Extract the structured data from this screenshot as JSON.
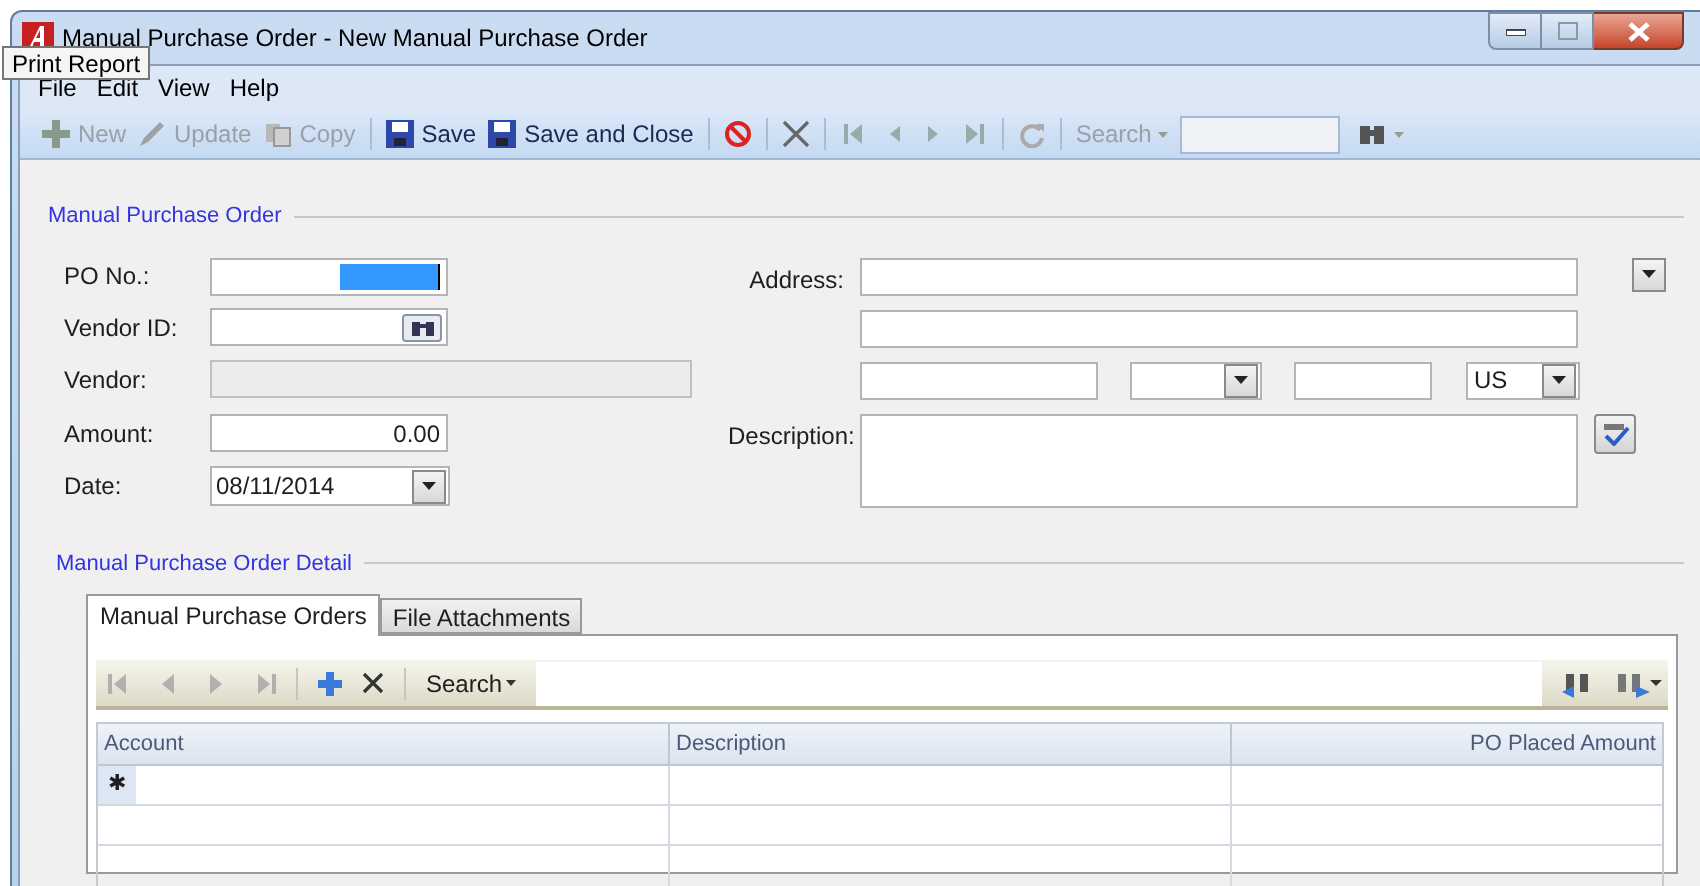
{
  "window": {
    "title": "Manual Purchase Order - New Manual Purchase Order"
  },
  "tooltip": {
    "text": "Print Report"
  },
  "menu": [
    "File",
    "Edit",
    "View",
    "Help"
  ],
  "toolbar": [
    {
      "kind": "new",
      "label": "New",
      "disabled": true
    },
    {
      "kind": "update",
      "label": "Update",
      "disabled": true
    },
    {
      "kind": "copy",
      "label": "Copy",
      "disabled": true
    },
    {
      "kind": "separator"
    },
    {
      "kind": "save",
      "label": "Save",
      "disabled": false
    },
    {
      "kind": "save",
      "label": "Save and Close",
      "disabled": false
    },
    {
      "kind": "separator"
    },
    {
      "kind": "cancel",
      "disabled": false
    },
    {
      "kind": "separator"
    },
    {
      "kind": "delete",
      "disabled": false
    },
    {
      "kind": "separator"
    },
    {
      "kind": "first",
      "disabled": true
    },
    {
      "kind": "prev",
      "disabled": true
    },
    {
      "kind": "next",
      "disabled": true
    },
    {
      "kind": "last",
      "disabled": true
    },
    {
      "kind": "separator"
    },
    {
      "kind": "refresh",
      "disabled": true
    },
    {
      "kind": "separator"
    },
    {
      "kind": "search",
      "label": "Search",
      "disabled": true
    },
    {
      "kind": "find",
      "disabled": true
    }
  ],
  "order": {
    "title": "Manual Purchase Order",
    "po_no": {
      "label": "PO No.:",
      "focused": true
    },
    "vendor_id": {
      "label": "Vendor ID:"
    },
    "vendor": {
      "label": "Vendor:",
      "disabled": true
    },
    "amount": {
      "label": "Amount:",
      "value": "0.00"
    },
    "date": {
      "label": "Date:",
      "value": "08/11/2014"
    },
    "address": {
      "label": "Address:"
    },
    "country": {
      "value": "US"
    },
    "description": {
      "label": "Description:"
    }
  },
  "detail": {
    "title": "Manual Purchase Order Detail",
    "tabs": [
      {
        "label": "Manual Purchase Orders",
        "selected": true
      },
      {
        "label": "File Attachments",
        "selected": false
      }
    ],
    "grid_toolbar": {
      "search": "Search"
    },
    "columns": [
      "Account",
      "Description",
      "PO Placed Amount"
    ],
    "new_row_marker": "✱"
  }
}
